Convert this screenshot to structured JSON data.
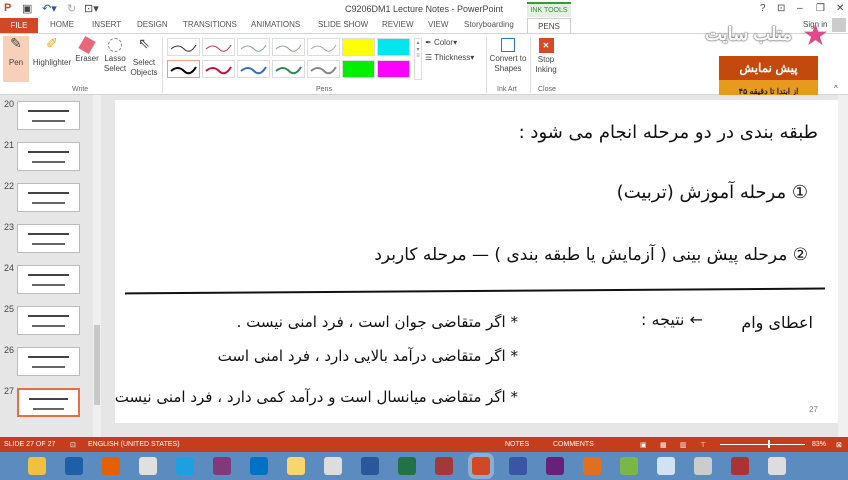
{
  "window": {
    "title": "C9206DM1 Lecture Notes - PowerPoint",
    "ink_tools": "INK TOOLS",
    "help": "?",
    "sign_in": "Sign in"
  },
  "tabs": [
    "FILE",
    "HOME",
    "INSERT",
    "DESIGN",
    "TRANSITIONS",
    "ANIMATIONS",
    "SLIDE SHOW",
    "REVIEW",
    "VIEW",
    "Storyboarding",
    "PENS"
  ],
  "ribbon": {
    "write": {
      "label": "Write",
      "pen": "Pen",
      "highlighter": "Highlighter",
      "eraser": "Eraser",
      "lasso": "Lasso Select",
      "select": "Select Objects"
    },
    "pens": {
      "label": "Pens",
      "color": "Color",
      "thickness": "Thickness",
      "swatches": [
        "#333333",
        "#c0394b",
        "#8aa3b8",
        "#8aa38a",
        "#aaaaaa",
        "#ffff00",
        "#00e5ee",
        "#000000",
        "#c0143c",
        "#2f6fc0",
        "#2e8b57",
        "#888888",
        "#00ee00",
        "#ff00ff"
      ]
    },
    "ink_art": {
      "label": "Ink Art",
      "convert": "Convert to Shapes"
    },
    "close": {
      "label": "Close",
      "stop": "Stop Inking"
    }
  },
  "overlay": {
    "logo": "متلب سایت",
    "promo_title": "پیش نمایش",
    "promo_sub": "از ابتدا تا دقیقه ۴۵"
  },
  "thumbnails": [
    "20",
    "21",
    "22",
    "23",
    "24",
    "25",
    "26",
    "27"
  ],
  "slide": {
    "number": "27",
    "lines": [
      "طبقه بندی در دو مرحله انجام می شود :",
      "① مرحله آموزش (تربیت)",
      "② مرحله پیش بینی ( آزمایش یا طبقه بندی ) — مرحله کاربرد",
      "اعطای وام",
      "← نتیجه :",
      "* اگر متقاضی جوان است ، فرد امنی نیست .",
      "* اگر متقاضی درآمد بالایی دارد ، فرد امنی است",
      "* اگر متقاضی میانسال است و درآمد کمی دارد ، فرد امنی نیست"
    ]
  },
  "status": {
    "slide": "SLIDE 27 OF 27",
    "language": "ENGLISH (UNITED STATES)",
    "notes": "NOTES",
    "comments": "COMMENTS",
    "zoom": "83%",
    "zoom_level": 0.83
  },
  "taskbar": {
    "icons": [
      "file-explorer",
      "onedrive",
      "firefox",
      "chrome",
      "internet-explorer",
      "onenote",
      "outlook",
      "pen-tool",
      "latex",
      "word",
      "excel",
      "access",
      "powerpoint",
      "visio",
      "visual-studio",
      "matlab",
      "notepad-plus",
      "notepad",
      "calculator",
      "paint",
      "keyboard"
    ],
    "colors": [
      "#f0c040",
      "#1e5fa8",
      "#e66000",
      "#e0e0e0",
      "#1ea0e0",
      "#80397b",
      "#0072c6",
      "#f5d76e",
      "#ddd",
      "#2b579a",
      "#217346",
      "#a4373a",
      "#d24726",
      "#3955a3",
      "#68217a",
      "#e07020",
      "#7ab648",
      "#cfe3f5",
      "#ccc",
      "#aa3333",
      "#ddd"
    ]
  }
}
